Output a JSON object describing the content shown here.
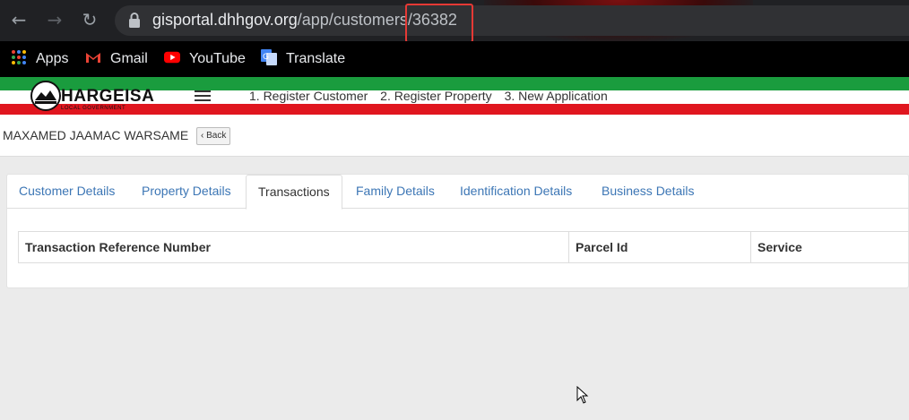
{
  "browser": {
    "url_host": "gisportal.dhhgov.org",
    "url_path": "/app/customers/",
    "url_id": "36382",
    "bookmarks": [
      {
        "label": "Apps",
        "icon": "apps-grid-icon"
      },
      {
        "label": "Gmail",
        "icon": "gmail-icon"
      },
      {
        "label": "YouTube",
        "icon": "youtube-icon"
      },
      {
        "label": "Translate",
        "icon": "translate-icon"
      }
    ]
  },
  "header": {
    "logo_title": "HARGEISA",
    "logo_subtitle": "LOCAL GOVERNMENT",
    "nav": [
      "1. Register Customer",
      "2. Register Property",
      "3. New Application"
    ]
  },
  "customer": {
    "name": "MAXAMED JAAMAC WARSAME",
    "back_label": "Back"
  },
  "tabs": [
    {
      "label": "Customer Details",
      "active": false
    },
    {
      "label": "Property Details",
      "active": false
    },
    {
      "label": "Transactions",
      "active": true
    },
    {
      "label": "Family Details",
      "active": false
    },
    {
      "label": "Identification Details",
      "active": false
    },
    {
      "label": "Business Details",
      "active": false
    }
  ],
  "table": {
    "columns": [
      "Transaction Reference Number",
      "Parcel Id",
      "Service"
    ]
  },
  "colors": {
    "accent_link": "#3c76b5",
    "stripe_green": "#1a9c3e",
    "stripe_red": "#e0161f",
    "highlight": "#e53935"
  }
}
